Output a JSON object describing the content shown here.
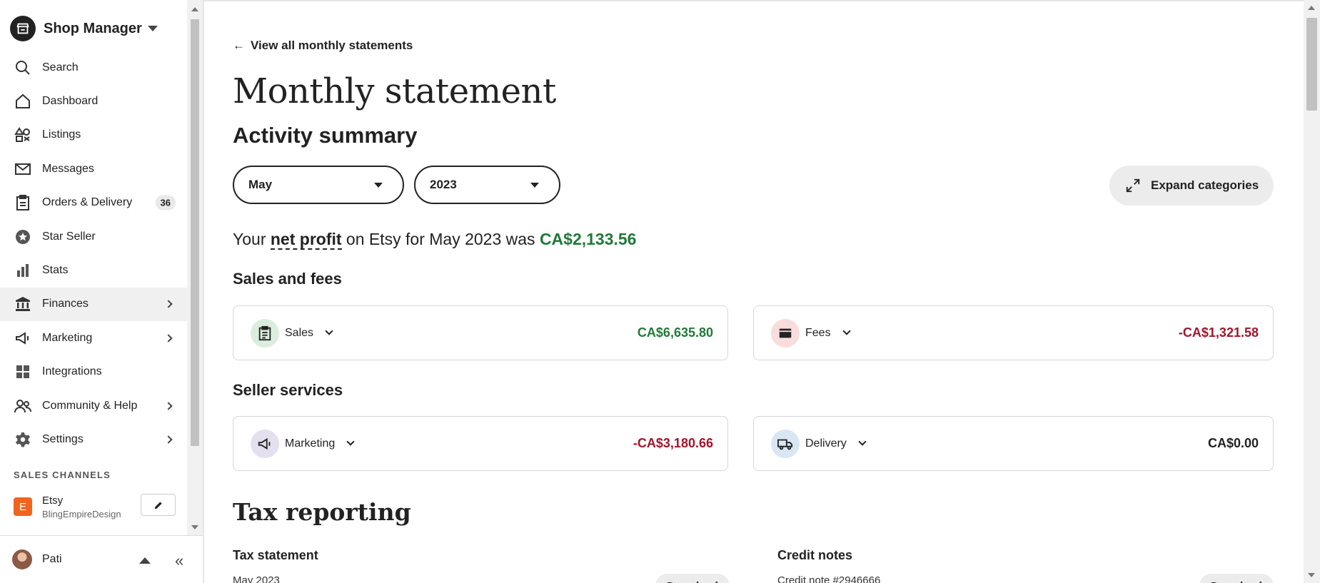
{
  "sidebar": {
    "title": "Shop Manager",
    "items": [
      {
        "label": "Search",
        "icon": "search-icon"
      },
      {
        "label": "Dashboard",
        "icon": "home-icon"
      },
      {
        "label": "Listings",
        "icon": "shapes-icon"
      },
      {
        "label": "Messages",
        "icon": "envelope-icon"
      },
      {
        "label": "Orders & Delivery",
        "icon": "clipboard-icon",
        "badge": "36"
      },
      {
        "label": "Star Seller",
        "icon": "star-seal-icon"
      },
      {
        "label": "Stats",
        "icon": "bar-chart-icon"
      },
      {
        "label": "Finances",
        "icon": "bank-icon",
        "active": true
      },
      {
        "label": "Marketing",
        "icon": "megaphone-icon"
      },
      {
        "label": "Integrations",
        "icon": "grid-icon"
      },
      {
        "label": "Community & Help",
        "icon": "people-icon"
      },
      {
        "label": "Settings",
        "icon": "gear-icon"
      }
    ],
    "channels_heading": "SALES CHANNELS",
    "channel": {
      "icon_letter": "E",
      "name": "Etsy",
      "shop": "BlingEmpireDesign"
    },
    "user": {
      "name": "Pati"
    }
  },
  "main": {
    "back_link": "View all monthly statements",
    "page_title": "Monthly statement",
    "section_title": "Activity summary",
    "month": "May",
    "year": "2023",
    "expand_label": "Expand categories",
    "net_profit": {
      "prefix": "Your",
      "term": "net profit",
      "middle": "on Etsy for May 2023 was",
      "amount": "CA$2,133.56"
    },
    "sales_fees_title": "Sales and fees",
    "seller_services_title": "Seller services",
    "cards": {
      "sales": {
        "label": "Sales",
        "amount": "CA$6,635.80"
      },
      "fees": {
        "label": "Fees",
        "amount": "-CA$1,321.58"
      },
      "marketing": {
        "label": "Marketing",
        "amount": "-CA$3,180.66"
      },
      "delivery": {
        "label": "Delivery",
        "amount": "CA$0.00"
      }
    },
    "tax": {
      "title": "Tax reporting",
      "statement_title": "Tax statement",
      "statement_sub": "May 2023",
      "credit_title": "Credit notes",
      "credit_sub": "Credit note #2946666",
      "download_label": "Download"
    }
  },
  "colors": {
    "positive": "#1f7a38",
    "negative": "#a0162b",
    "etsy": "#f1641e"
  }
}
